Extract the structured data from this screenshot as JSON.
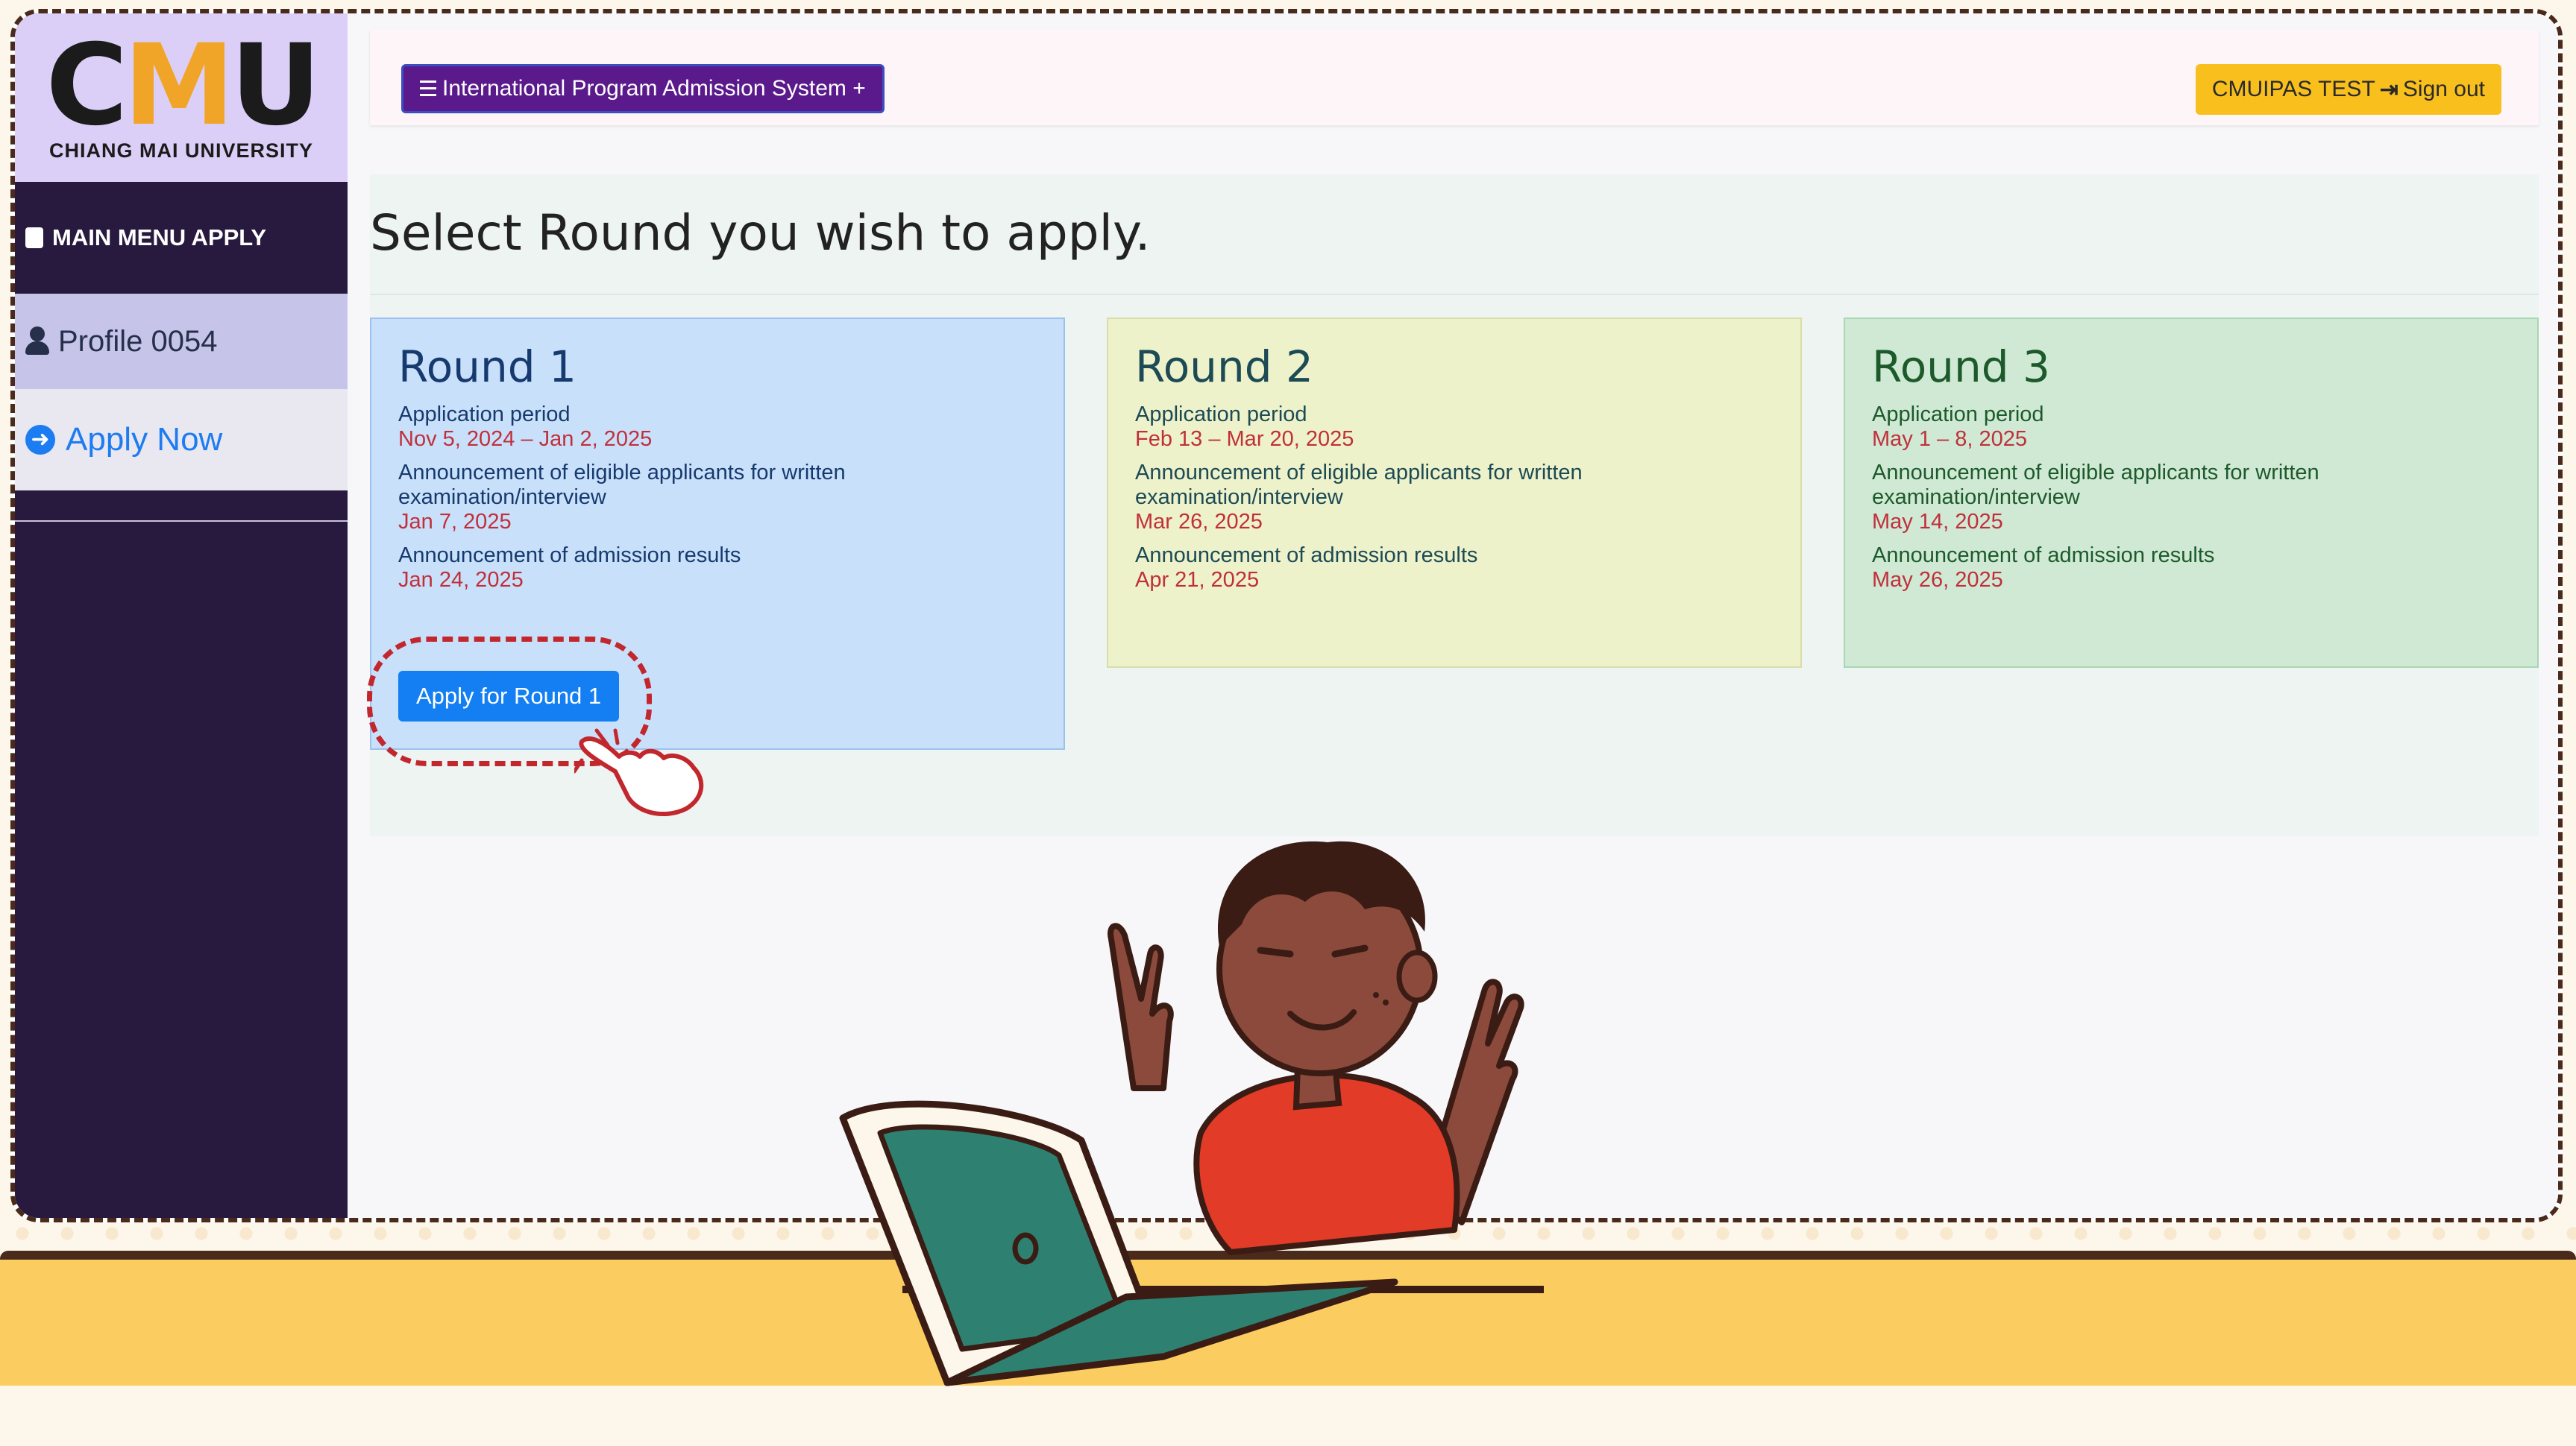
{
  "sidebar": {
    "logo_text": "CMU",
    "logo_subtitle": "CHIANG MAI UNIVERSITY",
    "menu_heading": "MAIN MENU APPLY",
    "items": [
      {
        "label": "Profile 0054",
        "icon": "user-icon"
      },
      {
        "label": "Apply Now",
        "icon": "arrow-circle-right-icon"
      }
    ]
  },
  "header": {
    "system_button": "International Program Admission System +",
    "user_label": "CMUIPAS TEST",
    "signout_label": "Sign out"
  },
  "page": {
    "title": "Select Round you wish to apply."
  },
  "rounds": [
    {
      "title": "Round 1",
      "app_label": "Application period",
      "app_value": "Nov 5, 2024 – Jan 2, 2025",
      "eligible_label": "Announcement of eligible applicants for written examination/interview",
      "eligible_value": "Jan 7, 2025",
      "result_label": "Announcement of admission results",
      "result_value": "Jan 24, 2025",
      "button": "Apply for Round 1"
    },
    {
      "title": "Round 2",
      "app_label": "Application period",
      "app_value": "Feb 13 – Mar 20, 2025",
      "eligible_label": "Announcement of eligible applicants for written examination/interview",
      "eligible_value": "Mar 26, 2025",
      "result_label": "Announcement of admission results",
      "result_value": "Apr 21, 2025"
    },
    {
      "title": "Round 3",
      "app_label": "Application period",
      "app_value": "May 1 – 8, 2025",
      "eligible_label": "Announcement of eligible applicants for written examination/interview",
      "eligible_value": "May 14, 2025",
      "result_label": "Announcement of admission results",
      "result_value": "May 26, 2025"
    }
  ],
  "colors": {
    "sidebar_bg": "#271a3e",
    "accent_blue": "#137ff2",
    "signout_bg": "#f9c01d",
    "date_red": "#c0303a",
    "highlight_red": "#c1272d"
  }
}
